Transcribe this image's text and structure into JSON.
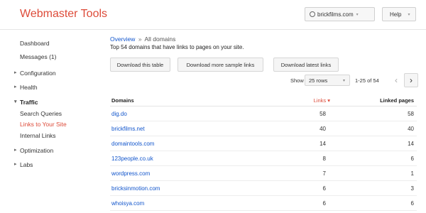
{
  "header": {
    "app_title": "Webmaster Tools",
    "site": "brickfilms.com",
    "help_label": "Help"
  },
  "sidebar": {
    "items": [
      {
        "label": "Dashboard"
      },
      {
        "label": "Messages (1)"
      },
      {
        "label": "Configuration"
      },
      {
        "label": "Health"
      },
      {
        "label": "Traffic"
      },
      {
        "label": "Search Queries"
      },
      {
        "label": "Links to Your Site"
      },
      {
        "label": "Internal Links"
      },
      {
        "label": "Optimization"
      },
      {
        "label": "Labs"
      }
    ]
  },
  "main": {
    "breadcrumb": {
      "link": "Overview",
      "sep": "»",
      "current": "All domains"
    },
    "subtitle": "Top 54 domains that have links to pages on your site.",
    "buttons": {
      "download_table": "Download this table",
      "download_sample": "Download more sample links",
      "download_latest": "Download latest links"
    },
    "pager": {
      "show_label": "Show",
      "rows_value": "25 rows",
      "range": "1-25 of 54"
    },
    "table": {
      "headers": {
        "domains": "Domains",
        "links": "Links",
        "linked_pages": "Linked pages"
      },
      "rows": [
        {
          "domain": "dig.do",
          "links": "58",
          "linked": "58"
        },
        {
          "domain": "brickfilms.net",
          "links": "40",
          "linked": "40"
        },
        {
          "domain": "domaintools.com",
          "links": "14",
          "linked": "14"
        },
        {
          "domain": "123people.co.uk",
          "links": "8",
          "linked": "6"
        },
        {
          "domain": "wordpress.com",
          "links": "7",
          "linked": "1"
        },
        {
          "domain": "bricksinmotion.com",
          "links": "6",
          "linked": "3"
        },
        {
          "domain": "whoisya.com",
          "links": "6",
          "linked": "6"
        }
      ]
    }
  },
  "colors": {
    "accent": "#dd4b39",
    "link": "#1155cc"
  }
}
